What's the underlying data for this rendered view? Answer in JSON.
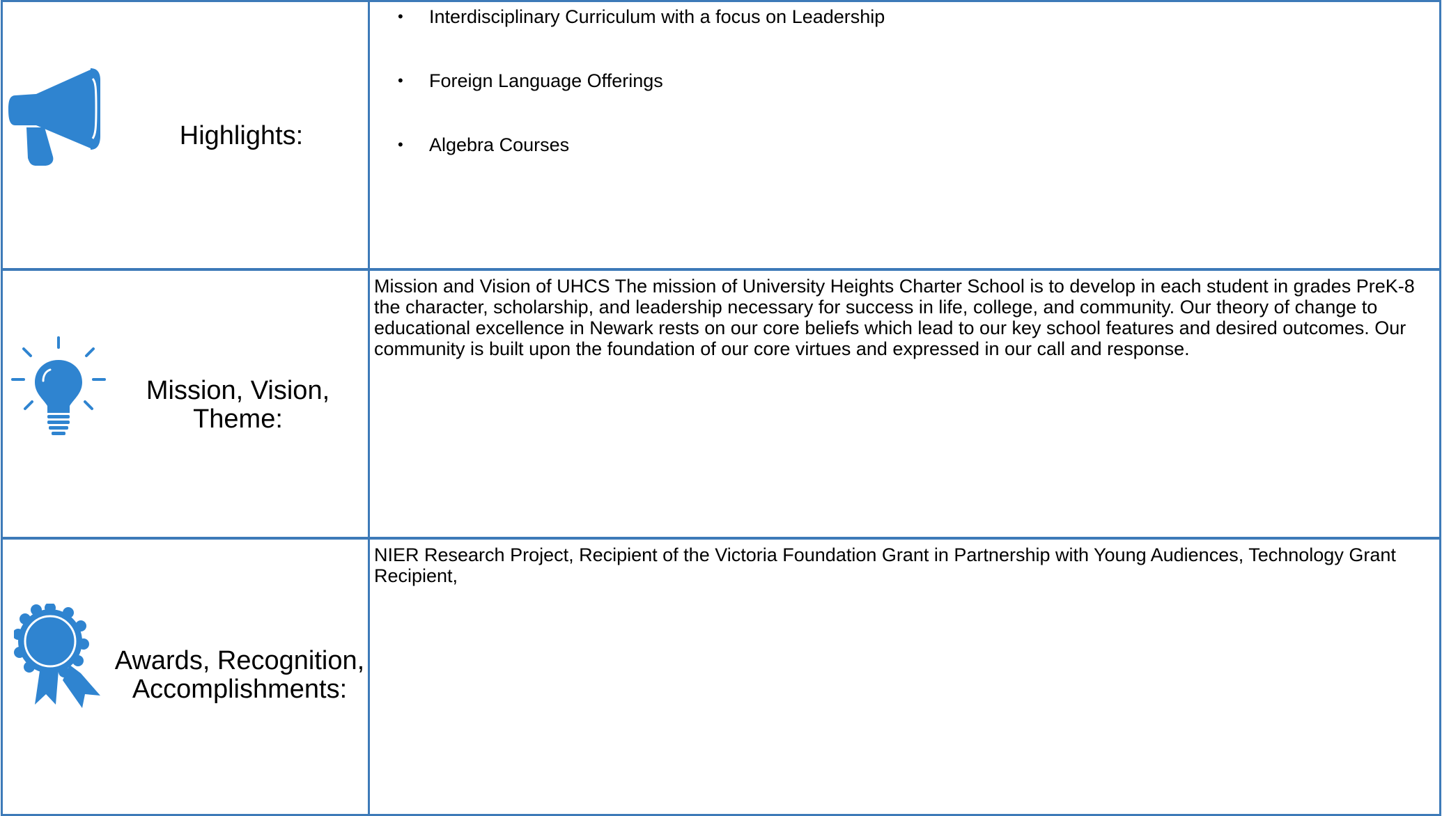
{
  "colors": {
    "border": "#3d7ab8",
    "icon": "#2f84d0"
  },
  "sections": [
    {
      "label": "Highlights:",
      "icon": "megaphone-icon",
      "items": [
        "Interdisciplinary Curriculum with a focus on Leadership",
        "Foreign Language Offerings",
        "Algebra Courses"
      ],
      "bullet": "•"
    },
    {
      "label_lines": [
        "Mission, Vision,",
        "Theme:"
      ],
      "icon": "lightbulb-icon",
      "text": "Mission and Vision of UHCS The mission of University Heights Charter School is to develop in each student in grades PreK-8 the character, scholarship, and leadership necessary for success in life, college, and community. Our theory of change to educational excellence in Newark rests on our core beliefs which lead to our key school features and desired outcomes. Our community is built upon the foundation of our core virtues and expressed in our call and response."
    },
    {
      "label_lines": [
        "Awards, Recognition,",
        "Accomplishments:"
      ],
      "icon": "award-ribbon-icon",
      "text": "NIER Research Project, Recipient of the Victoria Foundation Grant in Partnership with Young Audiences, Technology Grant Recipient,"
    }
  ]
}
